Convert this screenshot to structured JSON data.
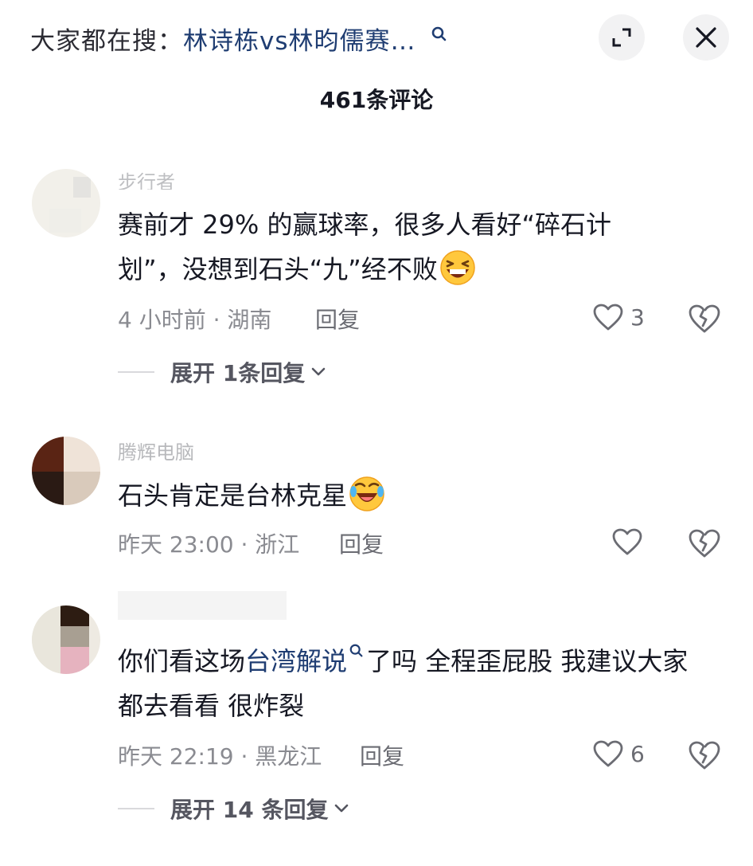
{
  "header": {
    "search_prefix": "大家都在搜：",
    "search_term": "林诗栋vs林昀儒赛…",
    "comment_count": "461条评论"
  },
  "comments": [
    {
      "username": "步行者",
      "text": "赛前才 29% 的赢球率，很多人看好“碎石计划”，没想到石头“九”经不败",
      "emoji": "laughing-emoji",
      "time_location": "4 小时前 · 湖南",
      "reply_label": "回复",
      "like_count": "3",
      "expand_label": "展开 1条回复"
    },
    {
      "username": "腾辉电脑",
      "text": "石头肯定是台林克星",
      "emoji": "rofl-emoji",
      "time_location": "昨天 23:00 · 浙江",
      "reply_label": "回复",
      "like_count": ""
    },
    {
      "username": "",
      "text_before": "你们看这场",
      "text_link": "台湾解说",
      "text_after": "了吗 全程歪屁股 我建议大家都去看看 很炸裂",
      "time_location": "昨天 22:19 · 黑龙江",
      "reply_label": "回复",
      "like_count": "6",
      "expand_label": "展开 14 条回复"
    }
  ],
  "icons": {
    "search": "search-icon",
    "expand": "expand-icon",
    "close": "close-icon",
    "like": "heart-icon",
    "dislike": "broken-heart-icon",
    "chevron": "chevron-down-icon"
  }
}
